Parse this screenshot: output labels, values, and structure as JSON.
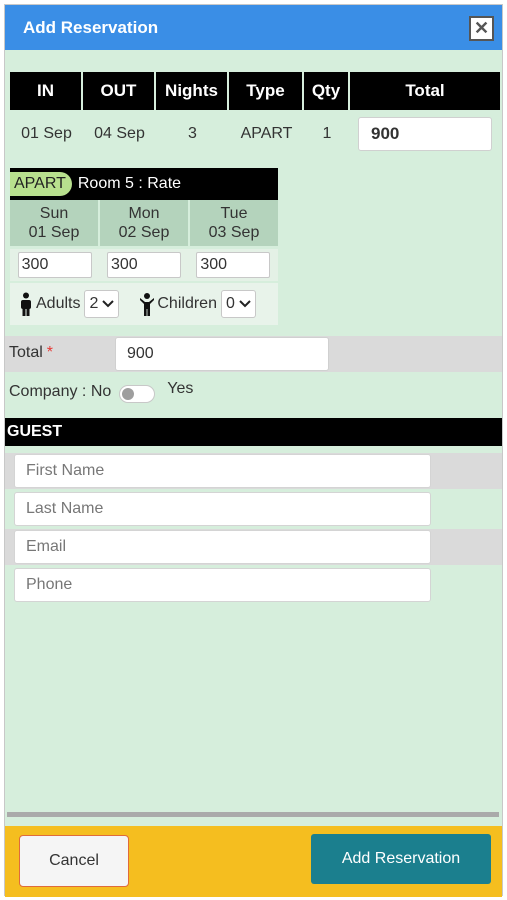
{
  "dialog": {
    "title": "Add Reservation",
    "close_symbol": "✕"
  },
  "summary": {
    "headers": [
      "IN",
      "OUT",
      "Nights",
      "Type",
      "Qty",
      "Total"
    ],
    "row": {
      "in": "01 Sep",
      "out": "04 Sep",
      "nights": "3",
      "type": "APART",
      "qty": "1",
      "total": "900"
    }
  },
  "rate": {
    "badge": "APART",
    "title": "Room 5 : Rate",
    "days": [
      {
        "dow": "Sun",
        "date": "01 Sep",
        "rate": "300"
      },
      {
        "dow": "Mon",
        "date": "02 Sep",
        "rate": "300"
      },
      {
        "dow": "Tue",
        "date": "03 Sep",
        "rate": "300"
      }
    ],
    "adults_label": "Adults",
    "adults_value": "2",
    "children_label": "Children",
    "children_value": "0"
  },
  "total": {
    "label": "Total",
    "required_mark": "*",
    "value": "900"
  },
  "company": {
    "label": "Company : No",
    "yes_label": "Yes",
    "enabled": false
  },
  "guest": {
    "header": "GUEST",
    "first_name_placeholder": "First Name",
    "last_name_placeholder": "Last Name",
    "email_placeholder": "Email",
    "phone_placeholder": "Phone"
  },
  "footer": {
    "cancel_label": "Cancel",
    "add_label": "Add Reservation"
  },
  "colors": {
    "title_bar": "#3a8ee6",
    "background": "#d6eedc",
    "footer": "#f5be1f",
    "primary_button": "#1b7f8e",
    "apart_badge": "#b8e08e"
  }
}
